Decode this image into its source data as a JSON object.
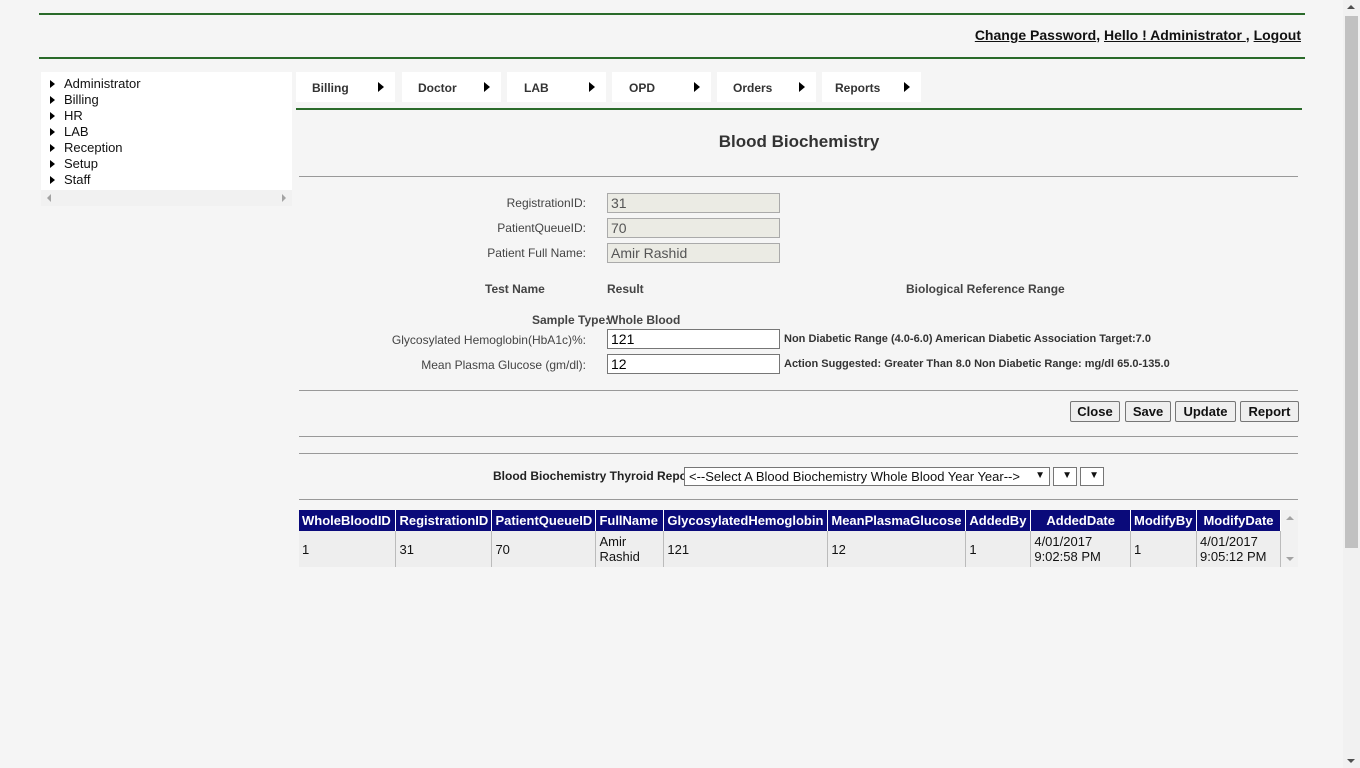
{
  "header": {
    "change_password": "Change Password",
    "greeting": "Hello ! Administrator ",
    "logout": "Logout"
  },
  "sidebar": {
    "items": [
      {
        "label": "Administrator"
      },
      {
        "label": "Billing"
      },
      {
        "label": "HR"
      },
      {
        "label": "LAB"
      },
      {
        "label": "Reception"
      },
      {
        "label": "Setup"
      },
      {
        "label": "Staff"
      }
    ]
  },
  "menu": {
    "items": [
      {
        "label": "Billing"
      },
      {
        "label": "Doctor"
      },
      {
        "label": "LAB"
      },
      {
        "label": "OPD"
      },
      {
        "label": "Orders"
      },
      {
        "label": "Reports"
      }
    ]
  },
  "page_title": "Blood Biochemistry",
  "form": {
    "registration_id_label": "RegistrationID:",
    "registration_id_value": "31",
    "patient_queue_id_label": "PatientQueueID:",
    "patient_queue_id_value": "70",
    "patient_name_label": "Patient Full Name:",
    "patient_name_value": "Amir Rashid",
    "col_test_name": "Test Name",
    "col_result": "Result",
    "col_reference": "Biological Reference Range",
    "sample_type_label": "Sample Type:",
    "sample_type_value": "Whole Blood",
    "hba1c_label": "Glycosylated Hemoglobin(HbA1c)%:",
    "hba1c_value": "121",
    "hba1c_range": "Non Diabetic Range (4.0-6.0) American Diabetic Association Target:7.0",
    "mpg_label": "Mean Plasma Glucose (gm/dl):",
    "mpg_value": "12",
    "mpg_range": "Action Suggested: Greater Than 8.0 Non Diabetic Range: mg/dl 65.0-135.0"
  },
  "buttons": {
    "close": "Close",
    "save": "Save",
    "update": "Update",
    "report": "Report"
  },
  "report_bar": {
    "label": "Blood Biochemistry Thyroid Report",
    "year_select": "<--Select A Blood Biochemistry Whole Blood Year Year-->",
    "select2": "",
    "select3": ""
  },
  "table": {
    "headers": [
      "WholeBloodID",
      "RegistrationID",
      "PatientQueueID",
      "FullName",
      "GlycosylatedHemoglobin",
      "MeanPlasmaGlucose",
      "AddedBy",
      "AddedDate",
      "ModifyBy",
      "ModifyDate"
    ],
    "rows": [
      [
        "1",
        "31",
        "70",
        "Amir Rashid",
        "121",
        "12",
        "1",
        "4/01/2017 9:02:58 PM",
        "1",
        "4/01/2017 9:05:12 PM"
      ]
    ]
  }
}
